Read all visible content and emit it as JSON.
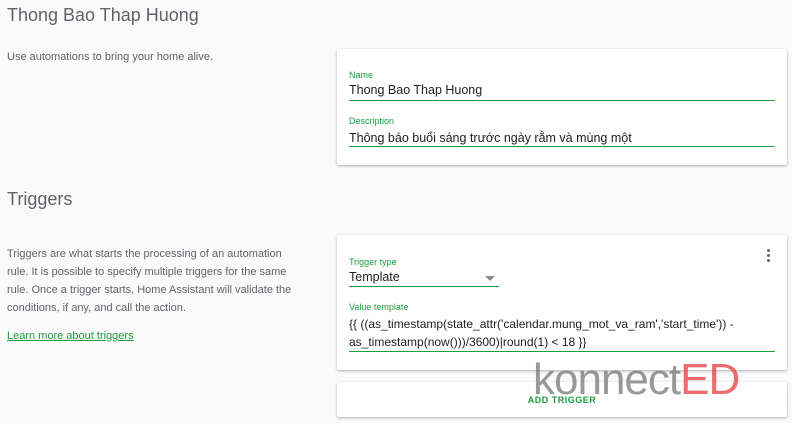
{
  "header": {
    "title": "Thong Bao Thap Huong",
    "description": "Use automations to bring your home alive."
  },
  "info_card": {
    "name_label": "Name",
    "name_value": "Thong Bao Thap Huong",
    "description_label": "Description",
    "description_value": "Thông báo buổi sáng trước ngày rằm và mùng một"
  },
  "triggers": {
    "title": "Triggers",
    "description": "Triggers are what starts the processing of an automation rule. It is possible to specify multiple triggers for the same rule. Once a trigger starts, Home Assistant will validate the conditions, if any, and call the action.",
    "learn_more": "Learn more about triggers",
    "trigger_type_label": "Trigger type",
    "trigger_type_value": "Template",
    "value_template_label": "Value template",
    "value_template_line1": "{{ ((as_timestamp(state_attr('calendar.mung_mot_va_ram','start_time')) -",
    "value_template_line2": "as_timestamp(now()))/3600)|round(1) < 18 }}",
    "add_trigger": "ADD TRIGGER"
  },
  "watermark": {
    "part1": "konnect",
    "part2": "ED"
  },
  "colors": {
    "accent": "#1b9e3e",
    "text_secondary": "#5f6368",
    "background": "#fafafa"
  },
  "icons": {
    "menu": "dots-vertical-icon",
    "dropdown": "chevron-down-icon"
  }
}
